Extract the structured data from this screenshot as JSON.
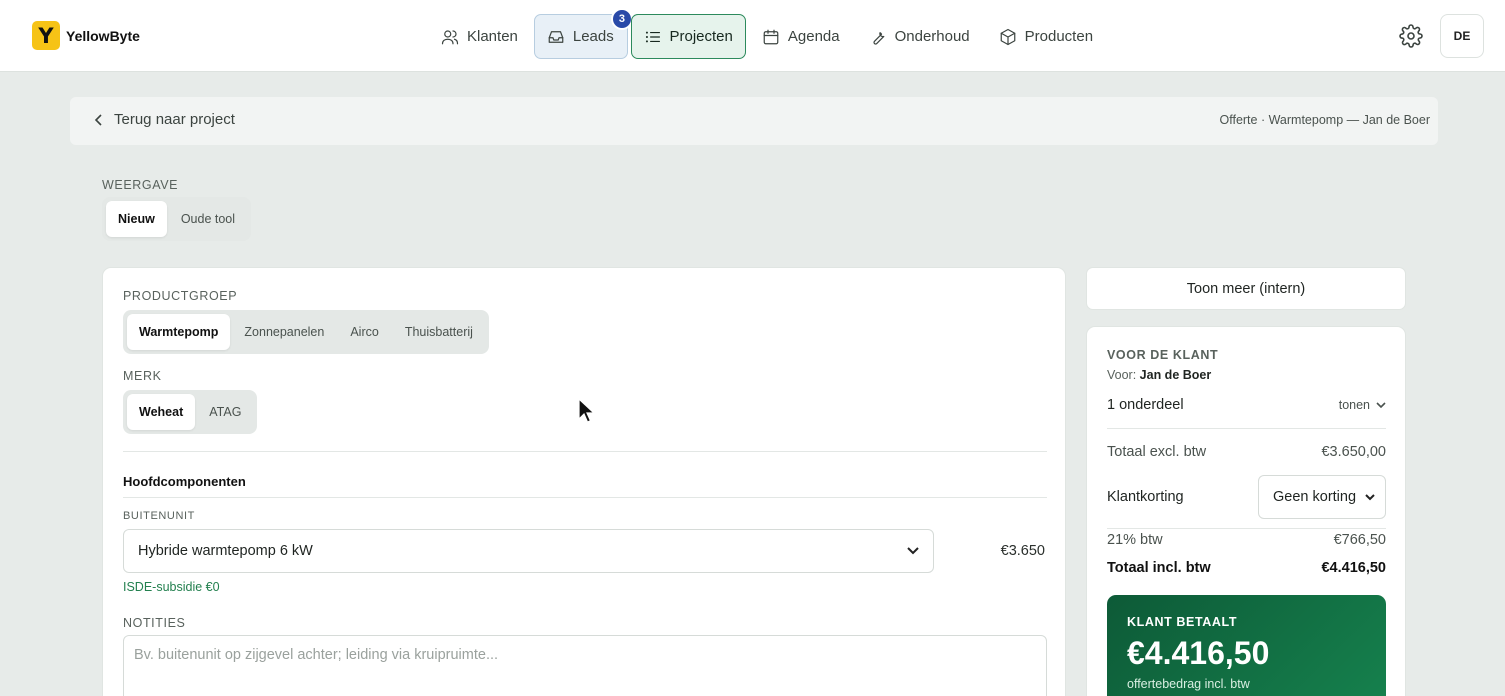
{
  "brand": {
    "logo_letter": "Y",
    "name": "YellowByte",
    "logo_color": "#f6c316"
  },
  "nav": {
    "items": [
      {
        "label": "Klanten",
        "icon": "users-icon"
      },
      {
        "label": "Leads",
        "icon": "inbox-icon",
        "badge": "3"
      },
      {
        "label": "Projecten",
        "icon": "list-icon",
        "active": true
      },
      {
        "label": "Agenda",
        "icon": "calendar-icon"
      },
      {
        "label": "Onderhoud",
        "icon": "wrench-icon"
      },
      {
        "label": "Producten",
        "icon": "box-icon"
      }
    ],
    "settings_icon": "gear-icon",
    "avatar": "DE"
  },
  "backbar": {
    "back_label": "Terug naar project",
    "breadcrumb": "Offerte · Warmtepomp — Jan de Boer"
  },
  "weergave": {
    "label": "WEERGAVE",
    "options": [
      "Nieuw",
      "Oude tool"
    ],
    "selected": "Nieuw"
  },
  "form": {
    "productgroep": {
      "label": "PRODUCTGROEP",
      "options": [
        "Warmtepomp",
        "Zonnepanelen",
        "Airco",
        "Thuisbatterij"
      ],
      "selected": "Warmtepomp"
    },
    "merk": {
      "label": "MERK",
      "options": [
        "Weheat",
        "ATAG"
      ],
      "selected": "Weheat"
    },
    "section_title": "Hoofdcomponenten",
    "buitenunit": {
      "label": "BUITENUNIT",
      "value": "Hybride warmtepomp 6 kW",
      "price": "€3.650",
      "subsidy": "ISDE-subsidie €0"
    },
    "notities": {
      "label": "NOTITIES",
      "placeholder": "Bv. buitenunit op zijgevel achter; leiding via kruipruimte..."
    }
  },
  "toon_meer": "Toon meer (intern)",
  "summary": {
    "heading": "VOOR DE KLANT",
    "for_prefix": "Voor:",
    "for_name": "Jan de Boer",
    "parts": "1 onderdeel",
    "tonen": "tonen",
    "excl_label": "Totaal excl. btw",
    "excl_value": "€3.650,00",
    "korting_label": "Klantkorting",
    "korting_value": "Geen korting",
    "btw_label": "21% btw",
    "btw_value": "€766,50",
    "incl_label": "Totaal incl. btw",
    "incl_value": "€4.416,50",
    "pay_label": "KLANT BETAALT",
    "pay_amount": "€4.416,50",
    "pay_sub": "offertebedrag incl. btw"
  },
  "colors": {
    "accent_green": "#16824e",
    "badge_blue": "#2a4aa8",
    "subsidy_green": "#23804f"
  }
}
